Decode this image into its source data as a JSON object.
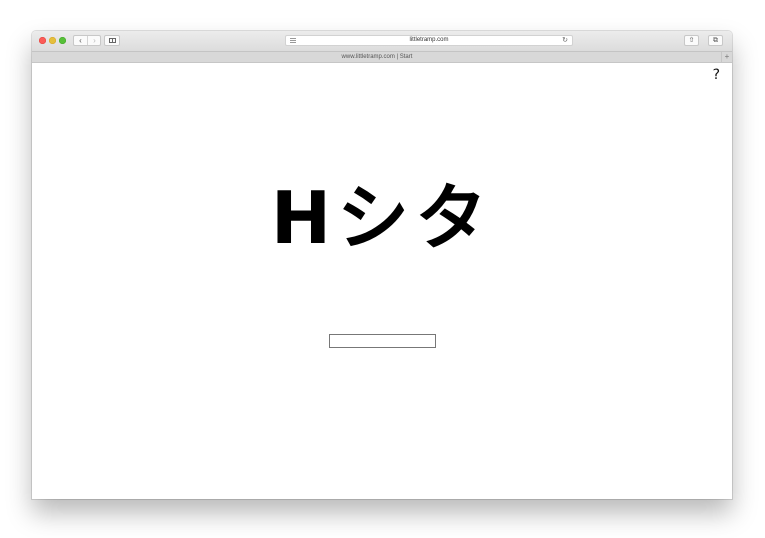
{
  "browser": {
    "address_url": "littletramp.com",
    "tab_title": "www.littletramp.com | Start",
    "nav_back_glyph": "‹",
    "nav_forward_glyph": "›",
    "reload_glyph": "↻",
    "share_glyph": "⇧",
    "tabs_glyph": "⧉",
    "new_tab_glyph": "+"
  },
  "page": {
    "help_label": "?",
    "logo_text": "Hシタ",
    "input_value": ""
  },
  "colors": {
    "close": "#fc5b57",
    "minimize": "#e5bf3c",
    "zoom": "#57c038",
    "logo": "#000000"
  }
}
